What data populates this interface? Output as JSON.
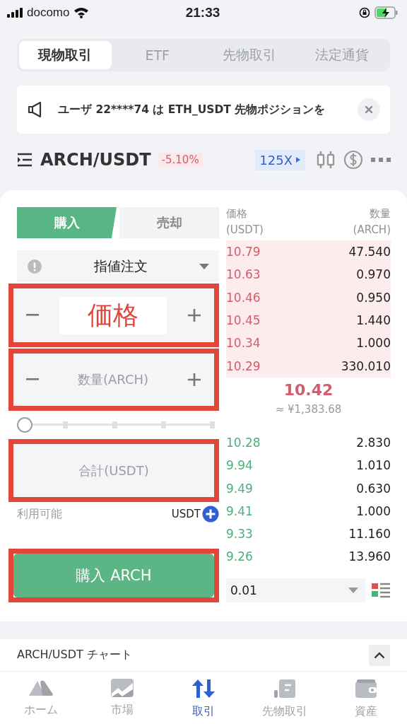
{
  "status_bar": {
    "carrier": "docomo",
    "time": "21:33"
  },
  "market_tabs": [
    {
      "label": "現物取引",
      "selected": true
    },
    {
      "label": "ETF",
      "selected": false
    },
    {
      "label": "先物取引",
      "selected": false
    },
    {
      "label": "法定通貨",
      "selected": false
    }
  ],
  "notice": {
    "text": "ユーザ 22****74 は ETH_USDT 先物ポジションを"
  },
  "pair": {
    "symbol": "ARCH/USDT",
    "change": "-5.10%",
    "leverage": "125X"
  },
  "side_tabs": [
    {
      "label": "購入",
      "selected": true
    },
    {
      "label": "売却",
      "selected": false
    }
  ],
  "order_type": "指値注文",
  "fields": [
    {
      "kind": "annotated",
      "label": "価格",
      "highlighted": true
    },
    {
      "kind": "stepper",
      "placeholder": "数量(ARCH)",
      "highlighted": true
    },
    {
      "kind": "slider",
      "level": 0
    },
    {
      "kind": "plain",
      "placeholder": "合計(USDT)",
      "highlighted": true
    }
  ],
  "available": {
    "label": "利用可能",
    "currency": "USDT"
  },
  "submit": {
    "label": "購入 ARCH",
    "highlighted": true
  },
  "order_book": {
    "price_header": "価格",
    "price_unit": "(USDT)",
    "qty_header": "数量",
    "qty_unit": "(ARCH)",
    "asks": [
      {
        "price": "10.79",
        "qty": "47.540"
      },
      {
        "price": "10.63",
        "qty": "0.970"
      },
      {
        "price": "10.46",
        "qty": "0.950"
      },
      {
        "price": "10.45",
        "qty": "1.440"
      },
      {
        "price": "10.34",
        "qty": "1.000"
      },
      {
        "price": "10.29",
        "qty": "330.010"
      }
    ],
    "last_price": "10.42",
    "last_price_jpy": "≈ ¥1,383.68",
    "bids": [
      {
        "price": "10.28",
        "qty": "2.830"
      },
      {
        "price": "9.94",
        "qty": "1.010"
      },
      {
        "price": "9.49",
        "qty": "0.630"
      },
      {
        "price": "9.41",
        "qty": "1.000"
      },
      {
        "price": "9.33",
        "qty": "11.160"
      },
      {
        "price": "9.26",
        "qty": "13.960"
      }
    ],
    "precision": "0.01"
  },
  "chart_bar": {
    "title": "ARCH/USDT チャート"
  },
  "bottom_nav": [
    {
      "kind": "home",
      "label": "ホーム",
      "selected": false
    },
    {
      "kind": "market",
      "label": "市場",
      "selected": false
    },
    {
      "kind": "trade",
      "label": "取引",
      "selected": true
    },
    {
      "kind": "futures",
      "label": "先物取引",
      "selected": false
    },
    {
      "kind": "assets",
      "label": "資産",
      "selected": false
    }
  ]
}
